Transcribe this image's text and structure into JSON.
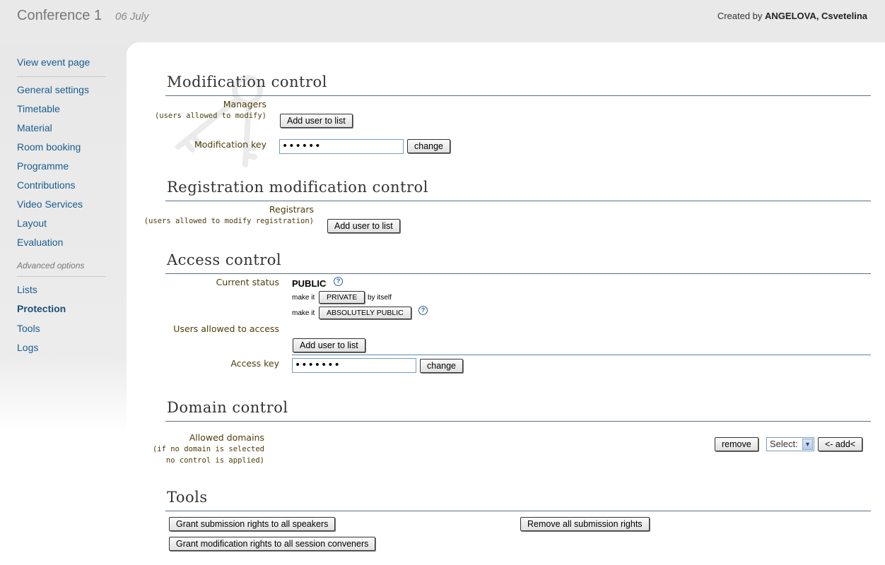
{
  "header": {
    "conference_title": "Conference 1",
    "conference_date": "06 July",
    "created_by_prefix": "Created by",
    "creator_name": "ANGELOVA, Csvetelina"
  },
  "sidebar": {
    "view_event_page": "View event page",
    "items": [
      "General settings",
      "Timetable",
      "Material",
      "Room booking",
      "Programme",
      "Contributions",
      "Video Services",
      "Layout",
      "Evaluation"
    ],
    "advanced_options_label": "Advanced options",
    "advanced_items": [
      "Lists",
      "Protection",
      "Tools",
      "Logs"
    ],
    "active_item": "Protection"
  },
  "modification_control": {
    "title": "Modification control",
    "managers_label": "Managers",
    "managers_sub": "(users allowed to modify)",
    "add_user_button": "Add user to list",
    "modification_key_label": "Modification key",
    "modification_key_value": "••••••",
    "change_button": "change"
  },
  "registration_control": {
    "title": "Registration modification control",
    "registrars_label": "Registrars",
    "registrars_sub": "(users allowed to modify registration)",
    "add_user_button": "Add user to list"
  },
  "access_control": {
    "title": "Access control",
    "current_status_label": "Current status",
    "current_status_value": "PUBLIC",
    "make_it_1": "make it",
    "private_button": "PRIVATE",
    "by_itself": "by itself",
    "make_it_2": "make it",
    "absolutely_public_button": "ABSOLUTELY PUBLIC",
    "users_allowed_label": "Users allowed to access",
    "add_user_button": "Add user to list",
    "access_key_label": "Access key",
    "access_key_value": "•••••••",
    "change_button": "change",
    "help_glyph": "?"
  },
  "domain_control": {
    "title": "Domain control",
    "allowed_domains_label": "Allowed domains",
    "allowed_domains_sub1": "(if no domain is selected",
    "allowed_domains_sub2": "no control is applied)",
    "remove_button": "remove",
    "select_value": "Select:",
    "add_button": "<- add<"
  },
  "tools": {
    "title": "Tools",
    "grant_submission_button": "Grant submission rights to all speakers",
    "grant_modification_button": "Grant modification rights to all session conveners",
    "remove_submission_button": "Remove all submission rights"
  }
}
